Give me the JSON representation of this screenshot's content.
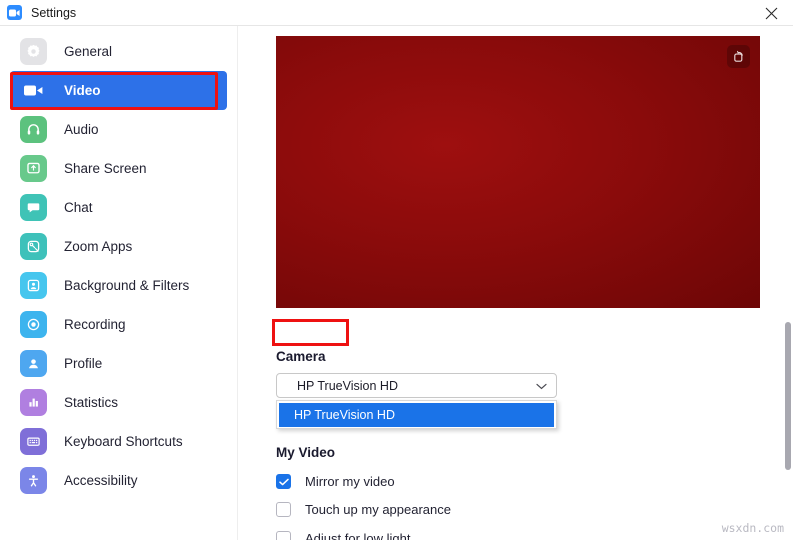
{
  "window": {
    "title": "Settings",
    "app_icon": "zoom-camera-icon",
    "close_label": "close-icon"
  },
  "sidebar": {
    "items": [
      {
        "label": "General",
        "icon": "gear-icon",
        "color": "#e3e3e6",
        "active": false
      },
      {
        "label": "Video",
        "icon": "video-camera-icon",
        "color": "#2d71e8",
        "active": true
      },
      {
        "label": "Audio",
        "icon": "headphones-icon",
        "color": "#5cc27e",
        "active": false
      },
      {
        "label": "Share Screen",
        "icon": "share-screen-icon",
        "color": "#68c98b",
        "active": false
      },
      {
        "label": "Chat",
        "icon": "chat-bubble-icon",
        "color": "#3fc3b6",
        "active": false
      },
      {
        "label": "Zoom Apps",
        "icon": "zoom-apps-icon",
        "color": "#3ec1ba",
        "active": false
      },
      {
        "label": "Background & Filters",
        "icon": "background-filters-icon",
        "color": "#46c6ee",
        "active": false
      },
      {
        "label": "Recording",
        "icon": "record-circle-icon",
        "color": "#3db4ee",
        "active": false
      },
      {
        "label": "Profile",
        "icon": "person-icon",
        "color": "#4ea7f0",
        "active": false
      },
      {
        "label": "Statistics",
        "icon": "bar-chart-icon",
        "color": "#b07fe0",
        "active": false
      },
      {
        "label": "Keyboard Shortcuts",
        "icon": "keyboard-icon",
        "color": "#7f6fd8",
        "active": false
      },
      {
        "label": "Accessibility",
        "icon": "accessibility-icon",
        "color": "#7b86e8",
        "active": false
      }
    ]
  },
  "main": {
    "video_preview": {
      "name": "camera-preview",
      "rotate_button": "rotate-camera-icon"
    },
    "camera": {
      "label": "Camera",
      "selected": "HP TrueVision HD",
      "dropdown_open": true,
      "options": [
        "HP TrueVision HD"
      ]
    },
    "my_video": {
      "label": "My Video",
      "checkboxes": [
        {
          "label": "Mirror my video",
          "checked": true
        },
        {
          "label": "Touch up my appearance",
          "checked": false
        },
        {
          "label": "Adjust for low light",
          "checked": false
        }
      ]
    }
  },
  "annotations": {
    "color": "#ee1111",
    "targets": [
      "Video",
      "Camera"
    ]
  },
  "watermark": {
    "text": "wsxdn.com"
  }
}
